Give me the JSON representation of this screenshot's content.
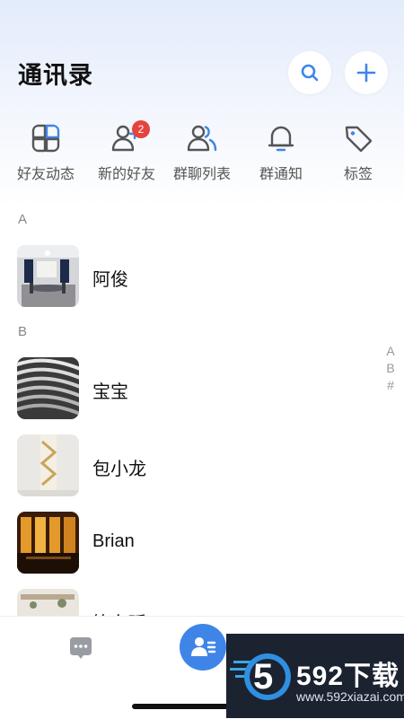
{
  "header": {
    "title": "通讯录"
  },
  "quick_actions": [
    {
      "label": "好友动态",
      "icon": "moments-icon"
    },
    {
      "label": "新的好友",
      "icon": "add-friend-icon",
      "badge": "2"
    },
    {
      "label": "群聊列表",
      "icon": "group-chat-icon"
    },
    {
      "label": "群通知",
      "icon": "bell-icon"
    },
    {
      "label": "标签",
      "icon": "tag-icon"
    }
  ],
  "sections": [
    {
      "letter": "A",
      "contacts": [
        {
          "name": "阿俊"
        }
      ]
    },
    {
      "letter": "B",
      "contacts": [
        {
          "name": "宝宝"
        },
        {
          "name": "包小龙"
        },
        {
          "name": "Brian"
        },
        {
          "name": "筱东瑶"
        }
      ]
    }
  ],
  "index_letters": [
    "A",
    "B",
    "#"
  ],
  "tabbar": {
    "active": "contacts"
  },
  "watermark": {
    "brand": "592下载",
    "url": "www.592xiazai.com",
    "digit": "5"
  },
  "colors": {
    "accent": "#3f85e8",
    "badge": "#e5443e"
  }
}
